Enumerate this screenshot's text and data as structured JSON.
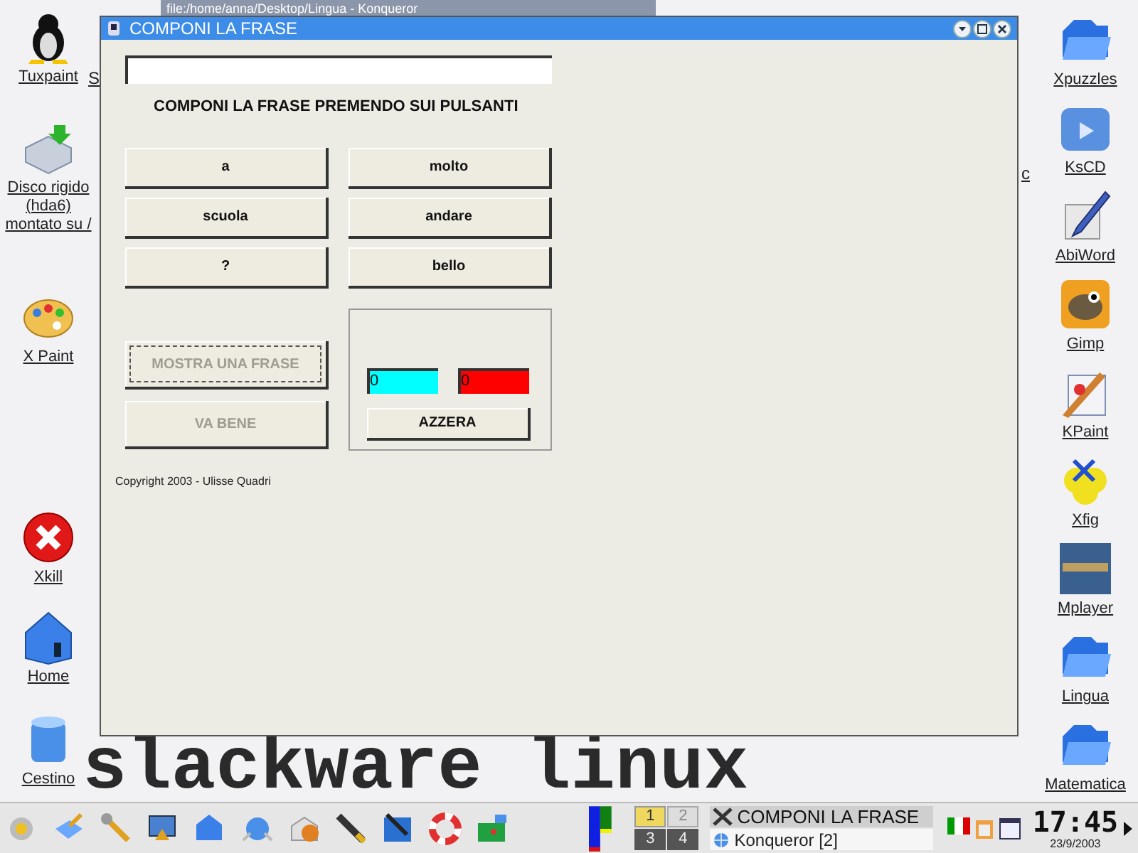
{
  "background_window": {
    "title": "file:/home/anna/Desktop/Lingua - Konqueror"
  },
  "desktop": {
    "wallpaper_text": "slackware linux",
    "icons_left": [
      {
        "label": "Tuxpaint",
        "kind": "penguin"
      },
      {
        "label": "Disco rigido (hda6) montato su /",
        "kind": "disk"
      },
      {
        "label": "X Paint",
        "kind": "palette"
      },
      {
        "label": "Xkill",
        "kind": "xkill"
      },
      {
        "label": "Home",
        "kind": "home"
      },
      {
        "label": "Cestino",
        "kind": "bin"
      }
    ],
    "icons_right": [
      {
        "label": "Xpuzzles",
        "kind": "folder"
      },
      {
        "label": "KsCD",
        "kind": "media"
      },
      {
        "label": "AbiWord",
        "kind": "pen"
      },
      {
        "label": "Gimp",
        "kind": "gimp"
      },
      {
        "label": "KPaint",
        "kind": "paint"
      },
      {
        "label": "Xfig",
        "kind": "fig"
      },
      {
        "label": "Mplayer",
        "kind": "video"
      },
      {
        "label": "Lingua",
        "kind": "folder"
      },
      {
        "label": "Matematica",
        "kind": "folder"
      }
    ],
    "hidden_labels": [
      "S",
      "c"
    ]
  },
  "window": {
    "title": "COMPONI LA FRASE",
    "instruction": "COMPONI LA FRASE PREMENDO SUI PULSANTI",
    "word_buttons": [
      "a",
      "molto",
      "scuola",
      "andare",
      "?",
      "bello"
    ],
    "action_buttons": [
      {
        "label": "MOSTRA UNA FRASE",
        "disabled": true,
        "focused": true
      },
      {
        "label": "VA BENE",
        "disabled": true,
        "focused": false
      }
    ],
    "counters": [
      {
        "value": "0",
        "color": "#00ffff"
      },
      {
        "value": "0",
        "color": "#ff0000"
      }
    ],
    "reset_button": "AZZERA",
    "copyright": "Copyright 2003 - Ulisse Quadri"
  },
  "taskbar": {
    "pager": [
      {
        "label": "1",
        "selected": true
      },
      {
        "label": "2",
        "selected": false
      },
      {
        "label": "3",
        "selected": false
      },
      {
        "label": "4",
        "selected": false
      }
    ],
    "tasks": [
      {
        "label": "COMPONI LA FRASE",
        "selected": true,
        "kind": "x11"
      },
      {
        "label": "Konqueror [2]",
        "selected": false,
        "kind": "browser"
      }
    ],
    "clock": {
      "time": "17:45",
      "date": "23/9/2003"
    }
  }
}
